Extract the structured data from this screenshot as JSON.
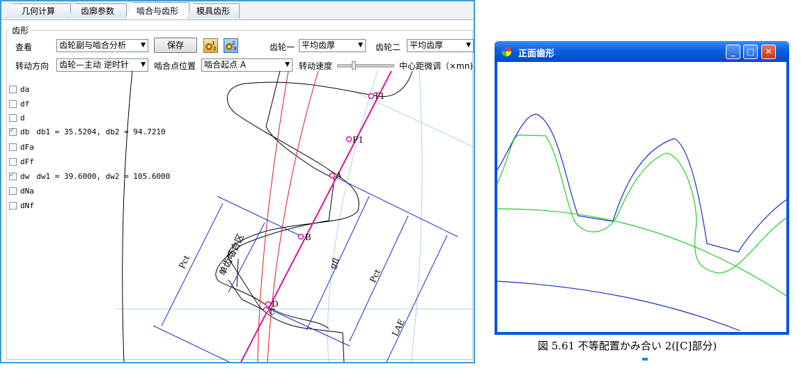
{
  "tabs": [
    "几何计算",
    "齿廓参数",
    "啮合与齿形",
    "模具齿形"
  ],
  "active_tab": 2,
  "group_title": "齿形",
  "row1": {
    "view_label": "查看",
    "view_value": "齿轮副与啮合分析",
    "save_label": "保存",
    "gear1_label": "齿轮一",
    "gear1_value": "平均齿厚",
    "gear2_label": "齿轮二",
    "gear2_value": "平均齿厚"
  },
  "row2": {
    "direction_label": "转动方向",
    "direction_value": "齿轮—主动 逆时针",
    "point_label": "啮合点位置",
    "point_value": "啮合起点 A",
    "speed_label": "转动速度",
    "center_label": "中心距微调（×mn)"
  },
  "icons": {
    "gear_pair_1": "gear-ratio-1-2-icon",
    "gear_pair_2": "gear-ratio-2-3-icon"
  },
  "circles": [
    {
      "name": "da",
      "checked": false,
      "text": ""
    },
    {
      "name": "df",
      "checked": false,
      "text": ""
    },
    {
      "name": "d",
      "checked": false,
      "text": ""
    },
    {
      "name": "db",
      "checked": true,
      "text": "db1 = 35.5204,  db2 = 94.7210"
    },
    {
      "name": "dFa",
      "checked": false,
      "text": ""
    },
    {
      "name": "dFf",
      "checked": false,
      "text": ""
    },
    {
      "name": "dw",
      "checked": true,
      "text": "dw1 = 39.6000,  dw2 = 105.6000"
    },
    {
      "name": "dNa",
      "checked": false,
      "text": ""
    },
    {
      "name": "dNf",
      "checked": false,
      "text": ""
    }
  ],
  "diagram_labels": {
    "T1": "T1",
    "F1": "F1",
    "A": "A",
    "B": "B",
    "D": "D",
    "C": "C",
    "pct_left": "Pct",
    "single_zone": "单齿啮合区",
    "gfl": "gfl",
    "pct_right": "Pct",
    "lae": "LAE"
  },
  "xp_window": {
    "title": "正面歯形"
  },
  "caption": "図 5.61  不等配置かみ合い 2([C]部分)",
  "colors": {
    "accent": "#3a9bd8",
    "line_of_action": "#e0109a",
    "dim_lines": "#1a2acc",
    "green_profile": "#22cc22"
  }
}
